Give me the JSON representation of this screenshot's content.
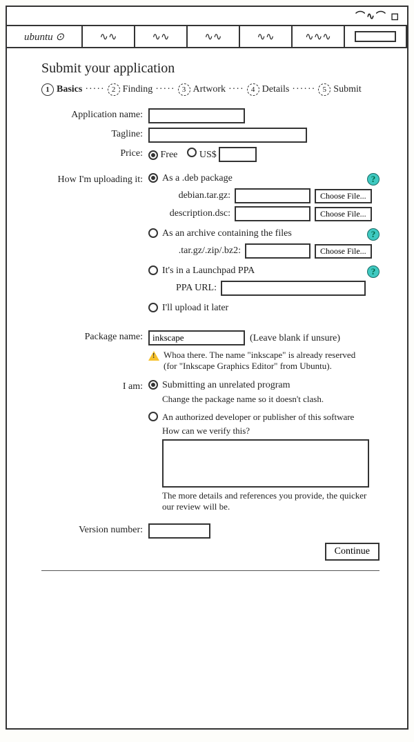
{
  "titlebar": {
    "scribble": "⌒∿⌒ ◻"
  },
  "nav": {
    "logo": "ubuntu ⊙",
    "tabs": [
      "∿∿",
      "∿∿",
      "∿∿",
      "∿∿",
      "∿∿∿"
    ]
  },
  "page_title": "Submit your application",
  "wizard": [
    {
      "num": "1",
      "label": "Basics",
      "active": true
    },
    {
      "num": "2",
      "label": "Finding"
    },
    {
      "num": "3",
      "label": "Artwork"
    },
    {
      "num": "4",
      "label": "Details"
    },
    {
      "num": "5",
      "label": "Submit"
    }
  ],
  "labels": {
    "app_name": "Application name:",
    "tagline": "Tagline:",
    "price": "Price:",
    "free": "Free",
    "usd": "US$",
    "upload": "How I'm uploading it:",
    "deb": "As a .deb package",
    "debian_tar": "debian.tar.gz:",
    "desc_dsc": "description.dsc:",
    "archive": "As an archive containing the files",
    "archive_ext": ".tar.gz/.zip/.bz2:",
    "ppa": "It's in a Launchpad PPA",
    "ppa_url": "PPA URL:",
    "later": "I'll upload it later",
    "choose": "Choose File...",
    "pkg_name": "Package name:",
    "pkg_hint": "(Leave blank if unsure)",
    "warn": "Whoa there. The name \"inkscape\" is already reserved (for \"Inkscape Graphics Editor\" from Ubuntu).",
    "iam": "I am:",
    "unrelated": "Submitting an unrelated program",
    "unrelated_sub": "Change the package name so it doesn't clash.",
    "authorized": "An authorized developer or publisher of this software",
    "verify": "How can we verify this?",
    "verify_hint": "The more details and references you provide, the quicker our review will be.",
    "version": "Version number:",
    "continue": "Continue"
  },
  "values": {
    "app_name": "",
    "tagline": "",
    "usd_amount": "",
    "pkg_name": "inkscape",
    "version": ""
  }
}
